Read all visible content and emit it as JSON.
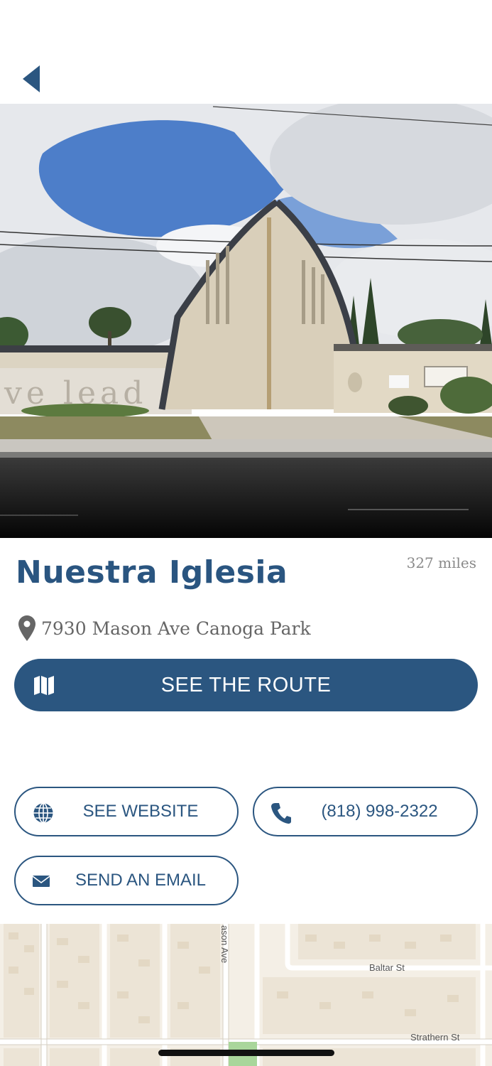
{
  "place": {
    "name": "Nuestra Iglesia",
    "distance": "327 miles",
    "address": "7930 Mason Ave Canoga Park"
  },
  "hero": {
    "sign_text": "ve lead"
  },
  "actions": {
    "route_label": "SEE THE ROUTE",
    "website_label": "SEE WEBSITE",
    "phone_label": "(818) 998-2322",
    "email_label": "SEND AN EMAIL"
  },
  "map": {
    "streets": {
      "mason": "ason Ave",
      "baltar": "Baltar St",
      "strathern": "Strathern St"
    }
  },
  "icons": {
    "back": "back-arrow-icon",
    "pin": "location-pin-icon",
    "map": "map-icon",
    "globe": "globe-icon",
    "phone": "phone-icon",
    "envelope": "envelope-icon"
  },
  "colors": {
    "brand_blue": "#2b5680",
    "text_gray": "#666666",
    "distance_gray": "#8a8a8a"
  }
}
